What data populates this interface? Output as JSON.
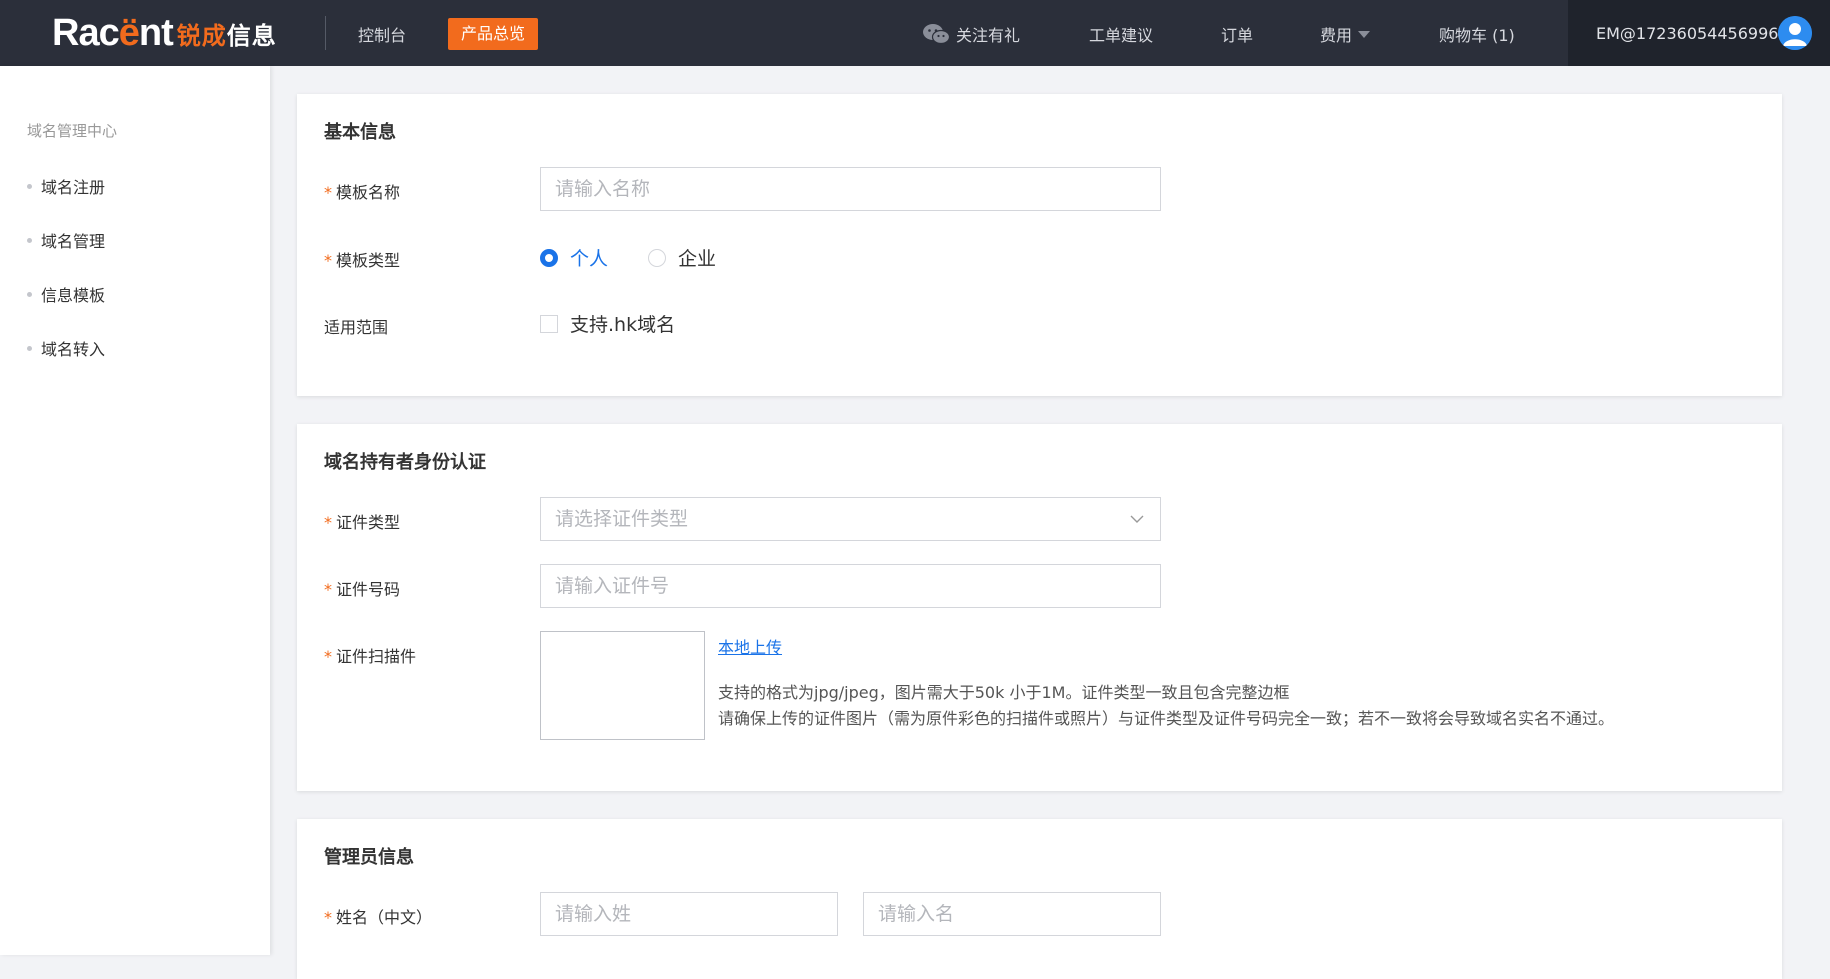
{
  "topbar": {
    "logo_word_a": "Rac",
    "logo_word_b": "ë",
    "logo_word_c": "nt",
    "logo_cn_a": "锐成",
    "logo_cn_b": "信息",
    "nav_console": "控制台",
    "nav_products": "产品总览",
    "follow": "关注有礼",
    "ticket": "工单建议",
    "orders": "订单",
    "fees": "费用",
    "cart": "购物车 (1)",
    "user": "EM@17236054456996",
    "accent_color": "#f26b1d"
  },
  "sidebar": {
    "title": "域名管理中心",
    "items": [
      {
        "label": "域名注册"
      },
      {
        "label": "域名管理"
      },
      {
        "label": "信息模板"
      },
      {
        "label": "域名转入"
      }
    ]
  },
  "basic_info": {
    "title": "基本信息",
    "template_name_label": "模板名称",
    "template_name_placeholder": "请输入名称",
    "template_type_label": "模板类型",
    "type_personal": "个人",
    "type_enterprise": "企业",
    "selected_type": "个人",
    "scope_label": "适用范围",
    "scope_hk": "支持.hk域名"
  },
  "identity": {
    "title": "域名持有者身份认证",
    "cert_type_label": "证件类型",
    "cert_type_placeholder": "请选择证件类型",
    "cert_no_label": "证件号码",
    "cert_no_placeholder": "请输入证件号",
    "scan_label": "证件扫描件",
    "upload_link": "本地上传",
    "note_1": "支持的格式为jpg/jpeg，图片需大于50k 小于1M。证件类型一致且包含完整边框",
    "note_2": "请确保上传的证件图片（需为原件彩色的扫描件或照片）与证件类型及证件号码完全一致；若不一致将会导致域名实名不通过。"
  },
  "admin": {
    "title": "管理员信息",
    "name_label": "姓名（中文）",
    "last_name_placeholder": "请输入姓",
    "first_name_placeholder": "请输入名"
  }
}
